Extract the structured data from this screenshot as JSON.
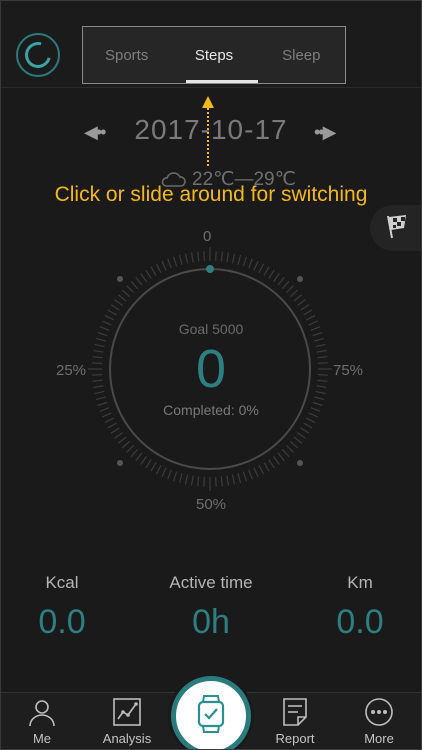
{
  "tabs": [
    {
      "label": "Sports",
      "active": false
    },
    {
      "label": "Steps",
      "active": true
    },
    {
      "label": "Sleep",
      "active": false
    }
  ],
  "date": {
    "text": "2017-10-17"
  },
  "weather": {
    "icon": "cloud-icon",
    "text": "22℃—29℃"
  },
  "hint": {
    "text": "Click or slide around for switching"
  },
  "dial": {
    "label_top": "0",
    "label_left": "25%",
    "label_right": "75%",
    "label_bottom": "50%",
    "goal_text": "Goal 5000",
    "value": "0",
    "completed_text": "Completed: 0%",
    "progress_fraction": 0
  },
  "stats": [
    {
      "label": "Kcal",
      "value": "0.0"
    },
    {
      "label": "Active time",
      "value": "0h"
    },
    {
      "label": "Km",
      "value": "0.0"
    }
  ],
  "nav": [
    {
      "label": "Me",
      "icon": "person-icon"
    },
    {
      "label": "Analysis",
      "icon": "chart-icon"
    },
    {
      "label": "Report",
      "icon": "report-icon"
    },
    {
      "label": "More",
      "icon": "more-icon"
    }
  ],
  "colors": {
    "accent": "#2e7f82",
    "hint": "#f5b81e",
    "background": "#1a1a1a"
  }
}
